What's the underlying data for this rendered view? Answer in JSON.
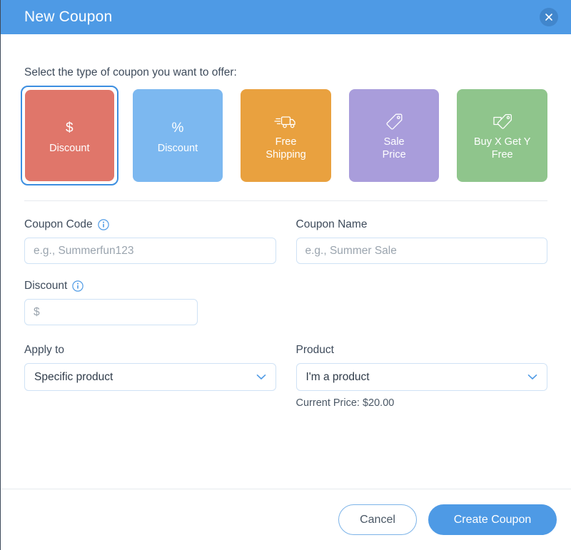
{
  "window": {
    "title": "New Coupon",
    "close_icon": "close-icon"
  },
  "body": {
    "select_type_label": "Select the type of coupon you want to offer:",
    "coupon_types": [
      {
        "label": "Discount",
        "icon": "dollar-sign-icon",
        "icon_glyph": "$",
        "color": "#e0766a",
        "selected": true
      },
      {
        "label": "Discount",
        "icon": "percent-sign-icon",
        "icon_glyph": "%",
        "color": "#7cb8f0",
        "selected": false
      },
      {
        "label": "Free\nShipping",
        "icon": "delivery-truck-icon",
        "icon_glyph": "",
        "color": "#e9a13f",
        "selected": false
      },
      {
        "label": "Sale\nPrice",
        "icon": "price-tag-icon",
        "icon_glyph": "",
        "color": "#a99ddb",
        "selected": false
      },
      {
        "label": "Buy X Get Y\nFree",
        "icon": "double-tag-icon",
        "icon_glyph": "",
        "color": "#8fc58c",
        "selected": false
      }
    ]
  },
  "form": {
    "coupon_code": {
      "label": "Coupon Code",
      "info_icon": "info-icon",
      "placeholder": "e.g., Summerfun123",
      "value": ""
    },
    "coupon_name": {
      "label": "Coupon Name",
      "placeholder": "e.g., Summer Sale",
      "value": ""
    },
    "discount": {
      "label": "Discount",
      "info_icon": "info-icon",
      "placeholder": "$",
      "value": ""
    },
    "apply_to": {
      "label": "Apply to",
      "value": "Specific product",
      "chevron_icon": "chevron-down-icon"
    },
    "product": {
      "label": "Product",
      "value": "I'm a product",
      "chevron_icon": "chevron-down-icon",
      "current_price": "Current Price: $20.00"
    }
  },
  "footer": {
    "cancel_label": "Cancel",
    "create_label": "Create Coupon"
  },
  "colors": {
    "header_blue": "#4e9ae5",
    "primary_blue": "#4e9ae5",
    "selected_ring": "#3c8ee0",
    "input_border": "#cfe2f5",
    "divider": "#e6eaee",
    "text_dark": "#3e4b5b"
  }
}
